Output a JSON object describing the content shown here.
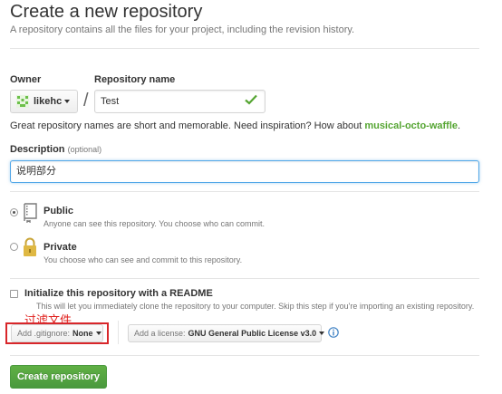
{
  "header": {
    "title": "Create a new repository",
    "subtitle": "A repository contains all the files for your project, including the revision history."
  },
  "owner": {
    "label": "Owner",
    "value": "likehc"
  },
  "repository_name": {
    "label": "Repository name",
    "value": "Test",
    "slash": "/"
  },
  "name_hint": {
    "text": "Great repository names are short and memorable. Need inspiration? How about ",
    "suggestion": "musical-octo-waffle",
    "end": "."
  },
  "description": {
    "label": "Description",
    "optional": "(optional)",
    "value": "说明部分"
  },
  "visibility": {
    "public": {
      "title": "Public",
      "desc": "Anyone can see this repository. You choose who can commit.",
      "selected": true
    },
    "private": {
      "title": "Private",
      "desc": "You choose who can see and commit to this repository.",
      "selected": false
    }
  },
  "readme": {
    "title": "Initialize this repository with a README",
    "desc": "This will let you immediately clone the repository to your computer. Skip this step if you're importing an existing repository.",
    "checked": false
  },
  "annotation": {
    "text": "过滤文件"
  },
  "gitignore": {
    "prefix": "Add .gitignore:",
    "value": "None"
  },
  "license": {
    "prefix": "Add a license:",
    "value": "GNU General Public License v3.0"
  },
  "create_button": {
    "label": "Create repository"
  },
  "colors": {
    "accent_green": "#55a532",
    "button_green": "#60b044",
    "focus_blue": "#51a7e8",
    "annotation_red": "#d8262a",
    "info_blue": "#4183c4"
  }
}
